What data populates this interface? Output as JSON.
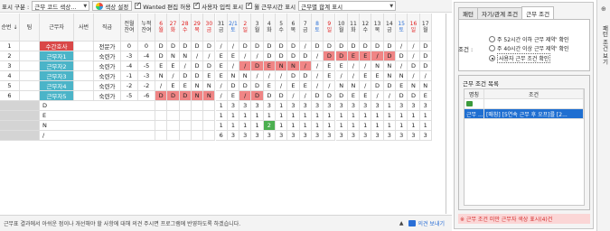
{
  "toolbar": {
    "display_label": "표시 구분 :",
    "display_select": "근무 코드 색상...",
    "color_setting": "색상 설정",
    "checks": [
      {
        "label": "Wanted 편집 허용",
        "checked": true
      },
      {
        "label": "사용자 입력 표시",
        "checked": true
      },
      {
        "label": "월 근무시간 표시",
        "checked": true
      }
    ],
    "summary_select": "근무별 합계 표시"
  },
  "grid": {
    "fixed_headers": [
      {
        "label": "순번",
        "sub": "",
        "w": 22,
        "sort": true
      },
      {
        "label": "팀",
        "sub": "",
        "w": 22,
        "sort": false
      },
      {
        "label": "근무자",
        "sub": "",
        "w": 38,
        "sort": false
      },
      {
        "label": "사번",
        "sub": "",
        "w": 22,
        "sort": false
      },
      {
        "label": "직급",
        "sub": "",
        "w": 30,
        "sort": false
      },
      {
        "label": "전월",
        "sub": "잔여",
        "w": 19,
        "sort": false
      },
      {
        "label": "누적",
        "sub": "잔여",
        "w": 19,
        "sort": false
      }
    ],
    "day_headers": [
      {
        "d": "6",
        "w": "월",
        "c": "red"
      },
      {
        "d": "27",
        "w": "화",
        "c": "red"
      },
      {
        "d": "28",
        "w": "수",
        "c": "red"
      },
      {
        "d": "29",
        "w": "목",
        "c": "red"
      },
      {
        "d": "30",
        "w": "금",
        "c": "red"
      },
      {
        "d": "31",
        "w": "금",
        "c": "black"
      },
      {
        "d": "2/1",
        "w": "토",
        "c": "blue"
      },
      {
        "d": "2",
        "w": "일",
        "c": "red"
      },
      {
        "d": "3",
        "w": "월",
        "c": "black"
      },
      {
        "d": "4",
        "w": "화",
        "c": "black"
      },
      {
        "d": "5",
        "w": "수",
        "c": "black"
      },
      {
        "d": "6",
        "w": "목",
        "c": "black"
      },
      {
        "d": "7",
        "w": "금",
        "c": "black"
      },
      {
        "d": "8",
        "w": "토",
        "c": "blue"
      },
      {
        "d": "9",
        "w": "일",
        "c": "red"
      },
      {
        "d": "10",
        "w": "월",
        "c": "black"
      },
      {
        "d": "11",
        "w": "화",
        "c": "black"
      },
      {
        "d": "12",
        "w": "수",
        "c": "black"
      },
      {
        "d": "13",
        "w": "목",
        "c": "black"
      },
      {
        "d": "14",
        "w": "금",
        "c": "black"
      },
      {
        "d": "15",
        "w": "토",
        "c": "blue"
      },
      {
        "d": "16",
        "w": "일",
        "c": "red"
      },
      {
        "d": "17",
        "w": "월",
        "c": "black"
      }
    ],
    "rows": [
      {
        "no": "1",
        "name": "수간호사",
        "name_color": "red",
        "rank": "전문가",
        "prev": "0",
        "cum": "0",
        "days": [
          "D",
          "D",
          "D",
          "D",
          "D",
          "/",
          "/",
          "D",
          "D",
          "D",
          "D",
          "D",
          "/",
          "D",
          "D",
          "D",
          "D",
          "D",
          "D",
          "D",
          "/",
          "/",
          "D"
        ],
        "hl": [
          null,
          null,
          null,
          null,
          null,
          null,
          null,
          null,
          null,
          null,
          null,
          null,
          null,
          null,
          null,
          null,
          null,
          null,
          null,
          null,
          null,
          null,
          null
        ]
      },
      {
        "no": "2",
        "name": "근무자1",
        "name_color": "teal",
        "rank": "숙련가",
        "prev": "-3",
        "cum": "-4",
        "days": [
          "D",
          "N",
          "N",
          "/",
          "/",
          "E",
          "E",
          "/",
          "/",
          "D",
          "D",
          "D",
          "D",
          "/",
          "D",
          "D",
          "E",
          "E",
          "/",
          "D",
          "D",
          "/",
          "D"
        ],
        "hl": [
          null,
          null,
          null,
          null,
          null,
          null,
          null,
          null,
          null,
          null,
          null,
          null,
          null,
          null,
          "dred",
          "dred",
          "dred",
          "dred",
          "dred",
          "dred",
          null,
          null,
          null
        ]
      },
      {
        "no": "3",
        "name": "근무자2",
        "name_color": "teal",
        "rank": "숙련가",
        "prev": "-4",
        "cum": "-5",
        "days": [
          "E",
          "E",
          "/",
          "D",
          "D",
          "E",
          "/",
          "/",
          "D",
          "E",
          "N",
          "N",
          "/",
          "/",
          "E",
          "E",
          "/",
          "/",
          "N",
          "N",
          "/",
          "D",
          "D"
        ],
        "hl": [
          null,
          null,
          null,
          null,
          null,
          null,
          null,
          "dred",
          "dred",
          "dred",
          "dred",
          "dred",
          "dred",
          null,
          null,
          null,
          null,
          null,
          null,
          null,
          null,
          null,
          null
        ]
      },
      {
        "no": "4",
        "name": "근무자3",
        "name_color": "teal",
        "rank": "숙련가",
        "prev": "-1",
        "cum": "-3",
        "days": [
          "N",
          "/",
          "D",
          "D",
          "E",
          "E",
          "N",
          "N",
          "/",
          "/",
          "/",
          "D",
          "D",
          "/",
          "E",
          "/",
          "/",
          "E",
          "E",
          "N",
          "N",
          "/",
          "/"
        ],
        "hl": [
          null,
          null,
          null,
          null,
          null,
          null,
          null,
          null,
          null,
          null,
          null,
          null,
          null,
          null,
          null,
          null,
          null,
          null,
          null,
          null,
          null,
          null,
          null
        ]
      },
      {
        "no": "5",
        "name": "근무자4",
        "name_color": "teal",
        "rank": "숙련가",
        "prev": "-2",
        "cum": "-2",
        "days": [
          "/",
          "E",
          "E",
          "N",
          "N",
          "/",
          "D",
          "D",
          "D",
          "E",
          "/",
          "E",
          "E",
          "/",
          "/",
          "N",
          "N",
          "/",
          "D",
          "D",
          "E",
          "N",
          "N"
        ],
        "hl": [
          null,
          null,
          null,
          null,
          null,
          null,
          null,
          null,
          null,
          null,
          null,
          null,
          null,
          null,
          null,
          null,
          null,
          null,
          null,
          null,
          null,
          null,
          null
        ]
      },
      {
        "no": "6",
        "name": "근무자5",
        "name_color": "teal",
        "rank": "숙련가",
        "prev": "-5",
        "cum": "-6",
        "days": [
          "D",
          "D",
          "D",
          "N",
          "N",
          "/",
          "E",
          "/",
          "D",
          "D",
          "D",
          "/",
          "/",
          "D",
          "D",
          "D",
          "E",
          "E",
          "/",
          "/",
          "D",
          "D",
          "E"
        ],
        "hl": [
          "dred",
          "dred",
          "dred",
          "dred",
          "dred",
          null,
          null,
          "dred",
          "dred",
          null,
          null,
          null,
          null,
          null,
          null,
          null,
          null,
          null,
          null,
          null,
          null,
          null,
          null
        ]
      }
    ],
    "summary": [
      {
        "label": "D",
        "days": [
          "",
          "",
          "",
          "",
          "",
          "1",
          "3",
          "3",
          "3",
          "3",
          "1",
          "3",
          "3",
          "3",
          "3",
          "3",
          "3",
          "3",
          "3",
          "1",
          "3",
          "3",
          "3"
        ]
      },
      {
        "label": "E",
        "days": [
          "",
          "",
          "",
          "",
          "",
          "1",
          "1",
          "1",
          "1",
          "1",
          "1",
          "1",
          "1",
          "1",
          "1",
          "1",
          "1",
          "1",
          "1",
          "1",
          "1",
          "1",
          "1"
        ]
      },
      {
        "label": "N",
        "days": [
          "",
          "",
          "",
          "",
          "",
          "1",
          "1",
          "1",
          "1",
          "2",
          "1",
          "1",
          "1",
          "1",
          "1",
          "1",
          "1",
          "1",
          "1",
          "1",
          "1",
          "1",
          "1"
        ]
      },
      {
        "label": "/",
        "days": [
          "",
          "",
          "",
          "",
          "",
          "6",
          "3",
          "3",
          "3",
          "3",
          "3",
          "3",
          "3",
          "3",
          "3",
          "3",
          "3",
          "3",
          "3",
          "3",
          "3",
          "3",
          "3"
        ]
      }
    ]
  },
  "status": {
    "message": "근무표 결과에서 아쉬운 점이나 개선해야 할 사항에 대해 의견 주시면 프로그램에 반영하도록 하겠습니다.",
    "feedback": "의견 보내기"
  },
  "panel": {
    "tabs": [
      "패턴",
      "자기/관계 조건",
      "근무 조건"
    ],
    "active_tab": 2,
    "condition_label": "조건 :",
    "radios": [
      {
        "label": "주 52시간 이하 근무 제약' 확인",
        "checked": false
      },
      {
        "label": "주 40시간 이상 근무 제약' 확인",
        "checked": false
      },
      {
        "label": "사용자 근무 조건 확인",
        "checked": true
      }
    ],
    "list_title": "근무 조건 목록",
    "list_headers": [
      "명칭",
      "조건"
    ],
    "list_rows": [
      {
        "name": "근무 ...",
        "cond": "[매칭] [5연속 근무 후 오프]를 [2..."
      }
    ],
    "warning": "※ 근무 조건 미만 근무자 색상 표시(4)건"
  },
  "side": {
    "title": "패턴 조건 보기"
  }
}
